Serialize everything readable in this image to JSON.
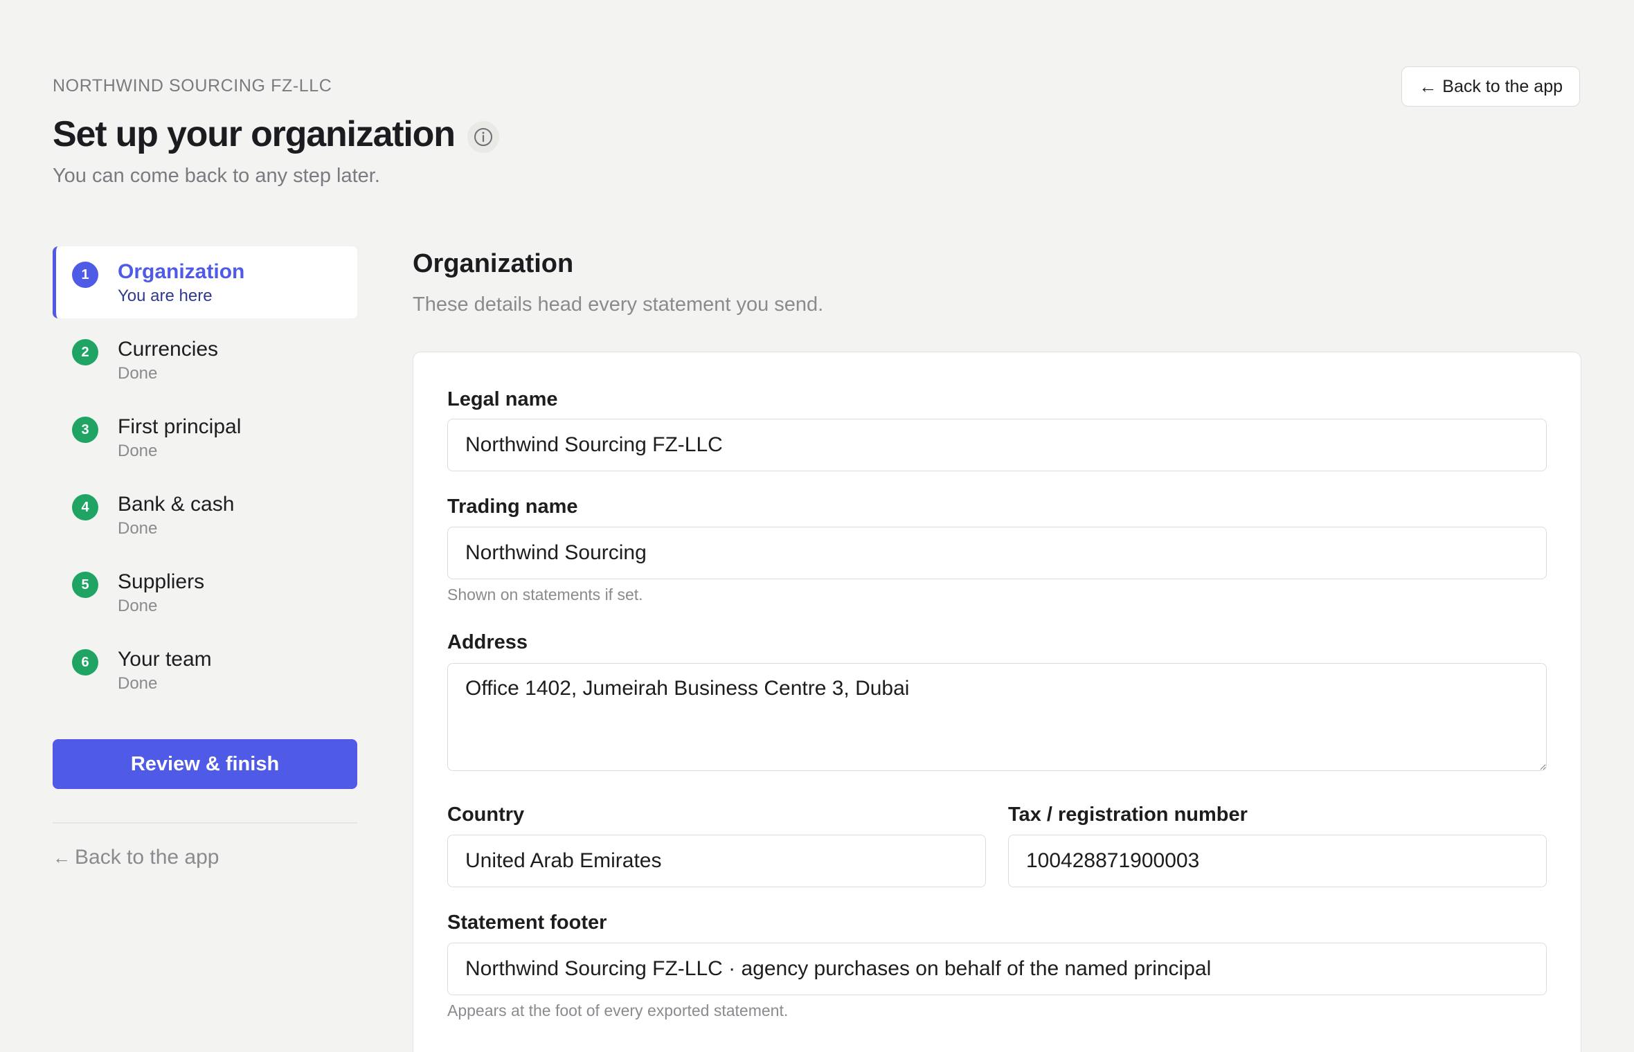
{
  "header": {
    "org_name": "NORTHWIND SOURCING FZ-LLC",
    "title": "Set up your organization",
    "subtitle": "You can come back to any step later.",
    "back_button": "Back to the app"
  },
  "icons": {
    "info": "info-icon",
    "back_arrow": "arrow-left-icon"
  },
  "colors": {
    "accent": "#4f5be6",
    "done": "#1fa463",
    "background": "#f3f3f1"
  },
  "steps": [
    {
      "number": "1",
      "label": "Organization",
      "status": "You are here",
      "state": "active"
    },
    {
      "number": "2",
      "label": "Currencies",
      "status": "Done",
      "state": "done"
    },
    {
      "number": "3",
      "label": "First principal",
      "status": "Done",
      "state": "done"
    },
    {
      "number": "4",
      "label": "Bank & cash",
      "status": "Done",
      "state": "done"
    },
    {
      "number": "5",
      "label": "Suppliers",
      "status": "Done",
      "state": "done"
    },
    {
      "number": "6",
      "label": "Your team",
      "status": "Done",
      "state": "done"
    }
  ],
  "sidebar": {
    "review_button": "Review & finish",
    "back_link": "Back to the app"
  },
  "section": {
    "title": "Organization",
    "description": "These details head every statement you send."
  },
  "form": {
    "legal_name": {
      "label": "Legal name",
      "value": "Northwind Sourcing FZ-LLC"
    },
    "trading_name": {
      "label": "Trading name",
      "value": "Northwind Sourcing",
      "hint": "Shown on statements if set."
    },
    "address": {
      "label": "Address",
      "value": "Office 1402, Jumeirah Business Centre 3, Dubai"
    },
    "country": {
      "label": "Country",
      "value": "United Arab Emirates"
    },
    "tax_number": {
      "label": "Tax / registration number",
      "value": "100428871900003"
    },
    "statement_footer": {
      "label": "Statement footer",
      "value": "Northwind Sourcing FZ-LLC · agency purchases on behalf of the named principal",
      "hint": "Appears at the foot of every exported statement."
    }
  }
}
